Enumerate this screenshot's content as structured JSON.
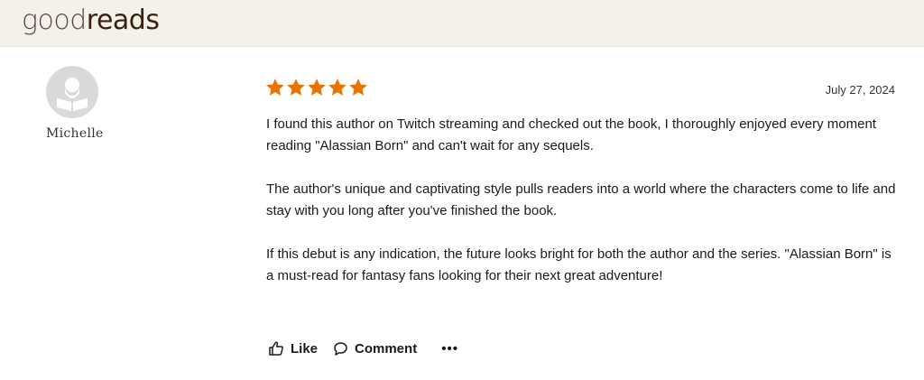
{
  "header": {
    "logo_light": "good",
    "logo_bold": "reads"
  },
  "reviewer": {
    "name": "Michelle",
    "avatar_icon": "reader-avatar-icon"
  },
  "review": {
    "rating": 5,
    "rating_max": 5,
    "date": "July 27, 2024",
    "paragraphs": [
      "I found this author on Twitch streaming and checked out the book, I thoroughly enjoyed every moment reading \"Alassian Born\" and can't wait for any sequels.",
      "The author's unique and captivating style pulls readers into a world where the characters come to life and stay with you long after you've finished the book.",
      "If this debut is any indication, the future looks bright for both the author and the series. \"Alassian Born\" is a must-read for fantasy fans looking for their next great adventure!"
    ]
  },
  "actions": {
    "like_label": "Like",
    "comment_label": "Comment",
    "more_label": "•••"
  },
  "colors": {
    "star": "#e87400",
    "header_bg": "#f4f1ea",
    "brand": "#382110"
  }
}
